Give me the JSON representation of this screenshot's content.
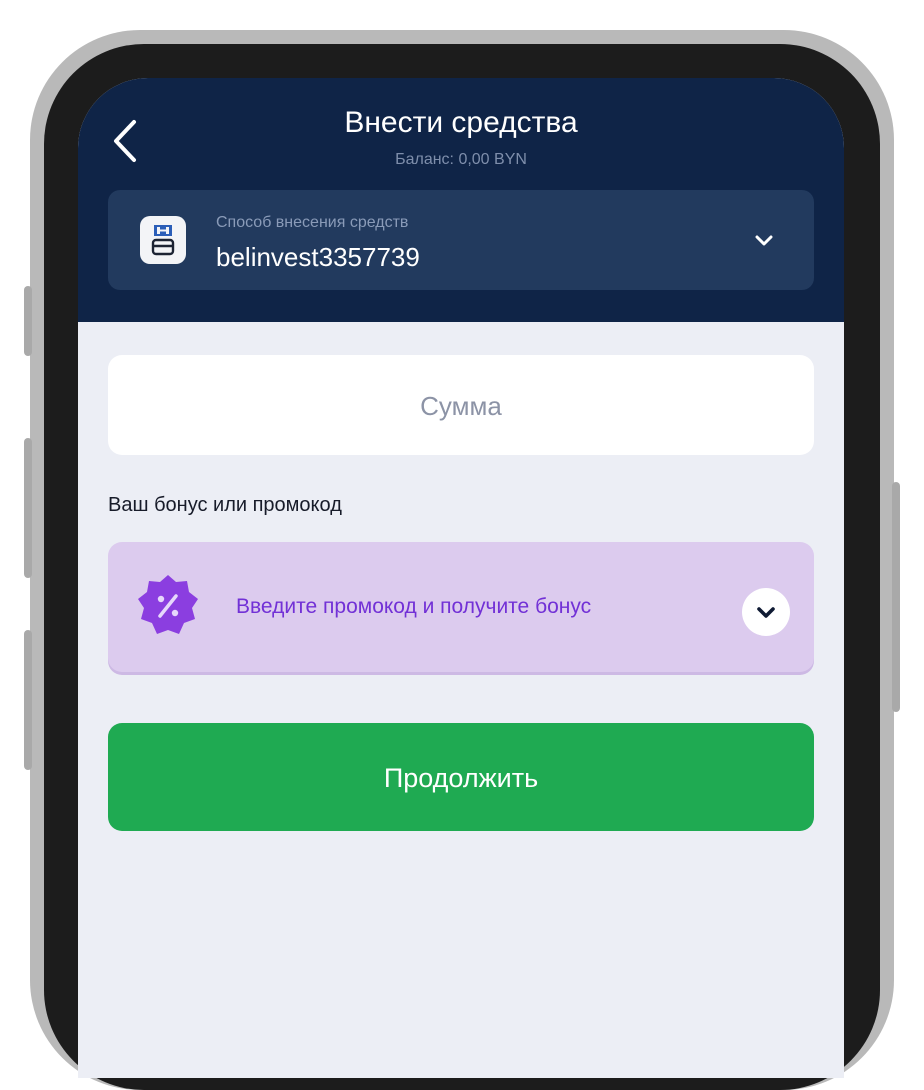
{
  "header": {
    "title": "Внести средства",
    "balance": "Баланс: 0,00 BYN"
  },
  "payment_method": {
    "caption": "Способ внесения средств",
    "value": "belinvest3357739",
    "icon": "bank-card-icon"
  },
  "amount": {
    "placeholder": "Сумма"
  },
  "bonus": {
    "label": "Ваш бонус или промокод",
    "promo_text": "Введите промокод и получите бонус",
    "icon": "percent-badge-icon"
  },
  "continue_button": {
    "label": "Продолжить"
  },
  "colors": {
    "header_bg": "#0f2447",
    "method_bg": "#223a5e",
    "screen_bg": "#eceef5",
    "promo_bg": "#dccbee",
    "promo_accent": "#7231d6",
    "continue_bg": "#1faa52"
  }
}
